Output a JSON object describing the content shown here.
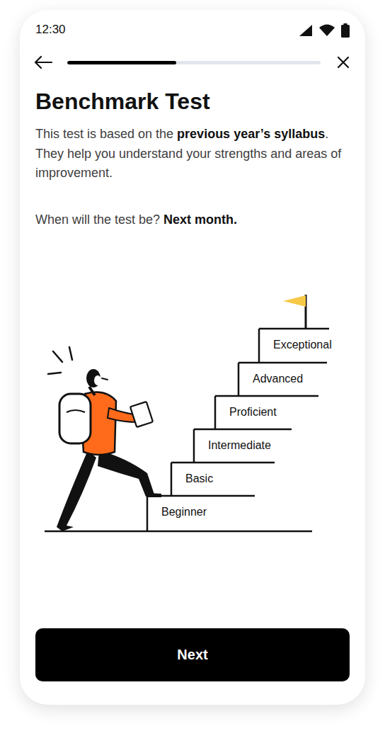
{
  "status_bar": {
    "time": "12:30"
  },
  "progress": {
    "level": 0.43
  },
  "title": "Benchmark Test",
  "description": [
    {
      "text": "This test is based on the ",
      "bold": false
    },
    {
      "text": "previous year’s syllabus",
      "bold": true
    },
    {
      "text": ". They help you understand your strengths and areas of improvement.",
      "bold": false
    }
  ],
  "schedule": [
    {
      "text": "When will the test be? ",
      "bold": false
    },
    {
      "text": "Next month.",
      "bold": true
    }
  ],
  "levels": [
    "Beginner",
    "Basic",
    "Intermediate",
    "Proficient",
    "Advanced",
    "Exceptional"
  ],
  "button": "Next"
}
